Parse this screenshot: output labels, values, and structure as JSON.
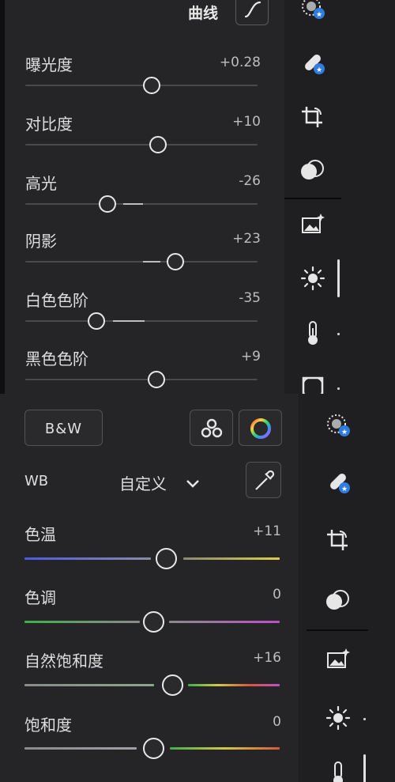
{
  "top_panel": {
    "curve_title": "曲线",
    "sliders": [
      {
        "label": "曝光度",
        "value": "+0.28",
        "level": 0.54
      },
      {
        "label": "对比度",
        "value": "+10",
        "level": 0.57
      },
      {
        "label": "高光",
        "value": "-26",
        "level": 0.35
      },
      {
        "label": "阴影",
        "value": "+23",
        "level": 0.64
      },
      {
        "label": "白色色阶",
        "value": "-35",
        "level": 0.3
      },
      {
        "label": "黑色色阶",
        "value": "+9",
        "level": 0.56
      }
    ]
  },
  "bottom_panel": {
    "bw_label": "B&W",
    "wb_label": "WB",
    "wb_preset": "自定义",
    "sliders": [
      {
        "label": "色温",
        "value": "+11",
        "level": 0.55
      },
      {
        "label": "色调",
        "value": "0",
        "level": 0.5
      },
      {
        "label": "自然饱和度",
        "value": "+16",
        "level": 0.58
      },
      {
        "label": "饱和度",
        "value": "0",
        "level": 0.5
      }
    ]
  },
  "rail_icons": [
    "selective-edit-icon",
    "healing-icon",
    "crop-icon",
    "mask-icon",
    "auto-icon",
    "light-icon",
    "temperature-icon",
    "vignette-icon"
  ],
  "colors": {
    "accent_blue": "#2f7de1",
    "panel_bg": "#252527",
    "knob": "#e8e8e8"
  }
}
